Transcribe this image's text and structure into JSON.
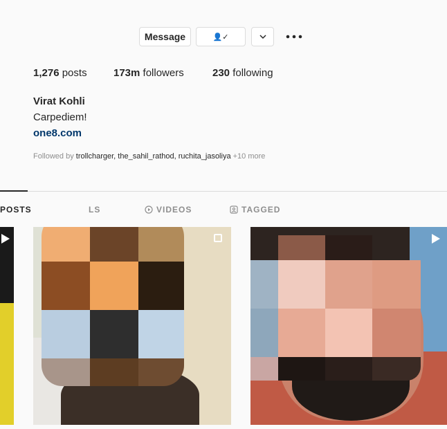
{
  "actions": {
    "message_label": "Message",
    "following_glyph": "👤✓",
    "dropdown_icon": "chevron-down-icon",
    "more_icon": "more-options-icon"
  },
  "stats": {
    "posts_count": "1,276",
    "posts_label": " posts",
    "followers_count": "173m",
    "followers_label": " followers",
    "following_count": "230",
    "following_label": " following"
  },
  "profile": {
    "name": "Virat Kohli",
    "bio": "Carpediem!",
    "link": "one8.com"
  },
  "followed_by": {
    "prefix": "Followed by ",
    "users": "trollcharger, the_sahil_rathod, ruchita_jasoliya",
    "suffix": " +10 more"
  },
  "tabs": [
    {
      "label": "POSTS",
      "icon": "grid-icon"
    },
    {
      "label": "LS",
      "icon": "reels-icon"
    },
    {
      "label": "VIDEOS",
      "icon": "video-icon"
    },
    {
      "label": "TAGGED",
      "icon": "tagged-icon"
    }
  ],
  "colors": {
    "link": "#00376b",
    "text": "#262626",
    "muted": "#8e8e8e",
    "border": "#dbdbdb"
  }
}
